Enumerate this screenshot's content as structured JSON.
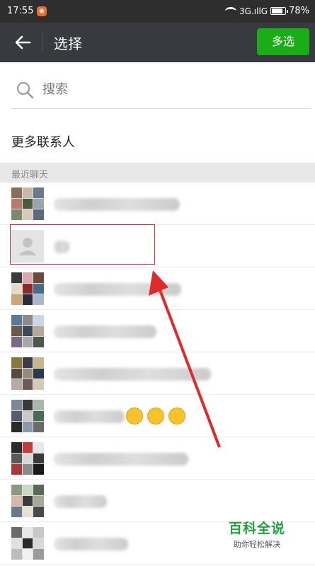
{
  "status_bar": {
    "time": "17:55",
    "network": "3G.ıllG",
    "battery": "78%",
    "battery_level": 0.78
  },
  "app_bar": {
    "title": "选择",
    "multi_select_label": "多选"
  },
  "search": {
    "placeholder": "搜索"
  },
  "more_contacts": {
    "label": "更多联系人"
  },
  "recent": {
    "header": "最近聊天"
  },
  "chats": [
    {
      "avatar": "group-grid",
      "name_visible": false
    },
    {
      "avatar": "default-person",
      "name_visible": false
    },
    {
      "avatar": "group-grid",
      "name_visible": false
    },
    {
      "avatar": "group-grid",
      "name_visible": false
    },
    {
      "avatar": "group-grid",
      "name_visible": false
    },
    {
      "avatar": "group-grid",
      "name_visible": false
    },
    {
      "avatar": "group-grid",
      "name_visible": false
    },
    {
      "avatar": "group-grid",
      "name_visible": false
    },
    {
      "avatar": "group-grid",
      "name_visible": false
    }
  ],
  "watermark": {
    "title": "百科全说",
    "subtitle": "助你轻松解决"
  },
  "colors": {
    "accent": "#1aad19",
    "app_bar": "#393a3f",
    "highlight": "#c9302c"
  }
}
